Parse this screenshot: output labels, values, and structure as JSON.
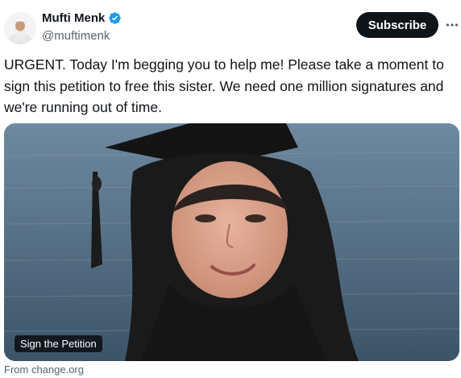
{
  "author": {
    "display_name": "Mufti Menk",
    "handle": "@muftimenk",
    "verified_icon": "verified-badge-icon",
    "avatar_icon": "avatar"
  },
  "actions": {
    "subscribe_label": "Subscribe",
    "more_label": "···"
  },
  "post": {
    "text": "URGENT. Today I'm begging you to help me! Please take a moment to sign this petition to free this sister. We need one million signatures and we're running out of time."
  },
  "link_card": {
    "label": "Sign the Petition",
    "source": "From change.org"
  },
  "colors": {
    "text": "#0f1419",
    "secondary": "#536471",
    "button_bg": "#0f1419",
    "verified": "#1d9bf0"
  }
}
